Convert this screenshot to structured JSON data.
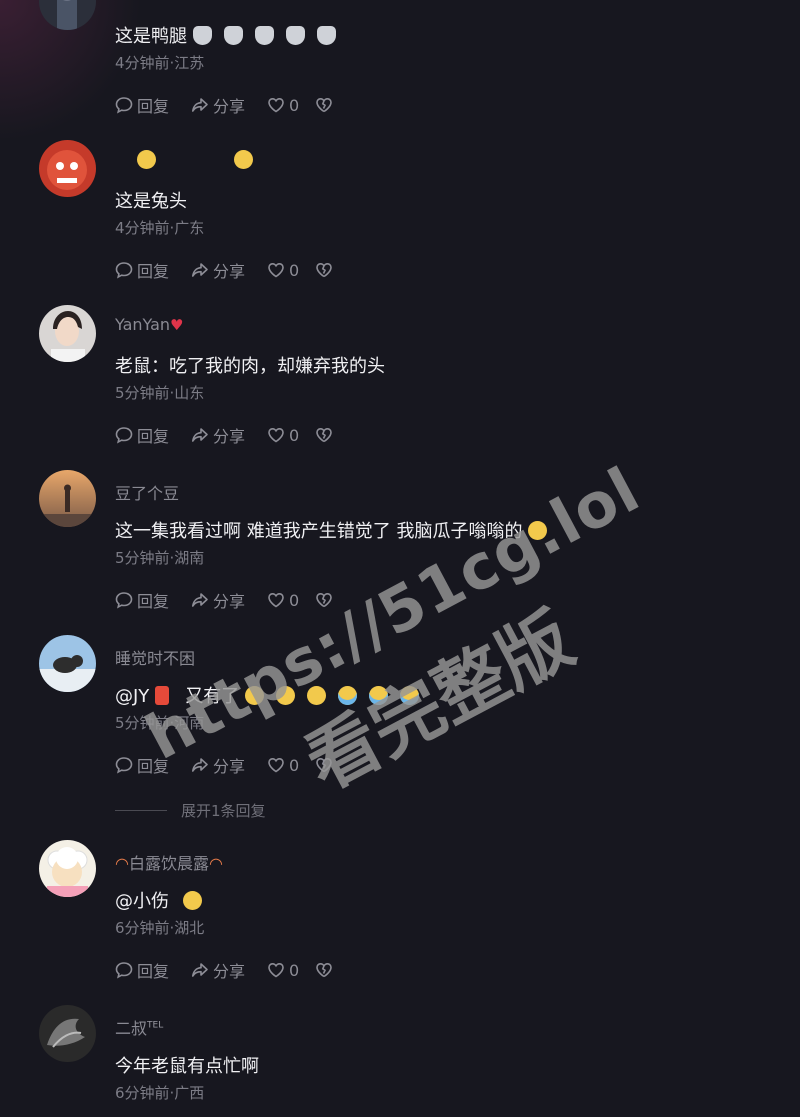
{
  "actions": {
    "reply": "回复",
    "share": "分享",
    "likes": "0"
  },
  "comments": [
    {
      "username": "",
      "text": "这是鸭腿",
      "meta": "4分钟前·江苏"
    },
    {
      "username": "",
      "text": "这是兔头",
      "meta": "4分钟前·广东"
    },
    {
      "username": "YanYan",
      "text": "老鼠：吃了我的肉，却嫌弃我的头",
      "meta": "5分钟前·山东"
    },
    {
      "username": "豆了个豆",
      "text": "这一集我看过啊 难道我产生错觉了 我脑瓜子嗡嗡的",
      "meta": "5分钟前·湖南"
    },
    {
      "username": "睡觉时不困",
      "text_mention": "@JY",
      "text": "又有了",
      "meta": "5分钟前·河南"
    },
    {
      "username": "白露饮晨露",
      "text": "@小伤",
      "meta": "6分钟前·湖北"
    },
    {
      "username": "二叔",
      "username_sup": "TEL",
      "text": "今年老鼠有点忙啊",
      "meta": "6分钟前·广西"
    }
  ],
  "expand_replies": "展开1条回复",
  "watermark": {
    "url": "https://51cg.lol",
    "subtitle": "看完整版"
  },
  "colors": {
    "background": "#17171f",
    "text": "#f0f0f3",
    "secondary": "#8a8a93",
    "heart": "#e0344a"
  }
}
